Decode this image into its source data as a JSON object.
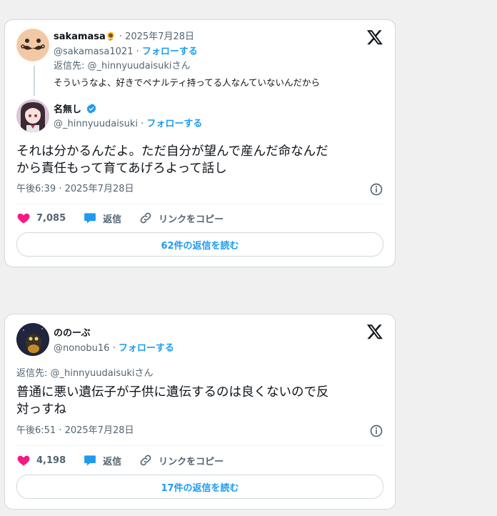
{
  "card1": {
    "quoted": {
      "name": "sakamasa",
      "name_emoji": "🌻",
      "date": "· 2025年7月28日",
      "handle": "@sakamasa1021",
      "follow": "フォローする",
      "reply_to": "返信先: @_hinnyuudaisukiさん",
      "text": "そういうなよ、好きでペナルティ持ってる人なんていないんだから"
    },
    "author": {
      "name": "名無し",
      "handle": "@_hinnyuudaisuki",
      "follow": "フォローする"
    },
    "text_line1": "それは分かるんだよ。ただ自分が望んで産んだ命なんだ",
    "text_line2": "から責任もって育てあげろよって話し",
    "timestamp": "午後6:39 · 2025年7月28日",
    "likes": "7,085",
    "reply_label": "返信",
    "copy_link_label": "リンクをコピー",
    "read_replies": "62件の返信を読む"
  },
  "card2": {
    "author": {
      "name": "ののーぶ",
      "handle": "@nonobu16",
      "follow": "フォローする"
    },
    "reply_to": "返信先: @_hinnyuudaisukiさん",
    "text_line1": "普通に悪い遺伝子が子供に遺伝するのは良くないので反",
    "text_line2": "対っすね",
    "timestamp": "午後6:51 · 2025年7月28日",
    "likes": "4,198",
    "reply_label": "返信",
    "copy_link_label": "リンクをコピー",
    "read_replies": "17件の返信を読む"
  },
  "colors": {
    "like": "#f91880",
    "reply": "#1d9bf0",
    "link": "#1d9bf0",
    "verified": "#1d9bf0"
  },
  "icons": [
    "x-logo-icon",
    "heart-icon",
    "reply-bubble-icon",
    "link-icon",
    "info-icon",
    "verified-badge-icon",
    "sunflower-emoji"
  ]
}
